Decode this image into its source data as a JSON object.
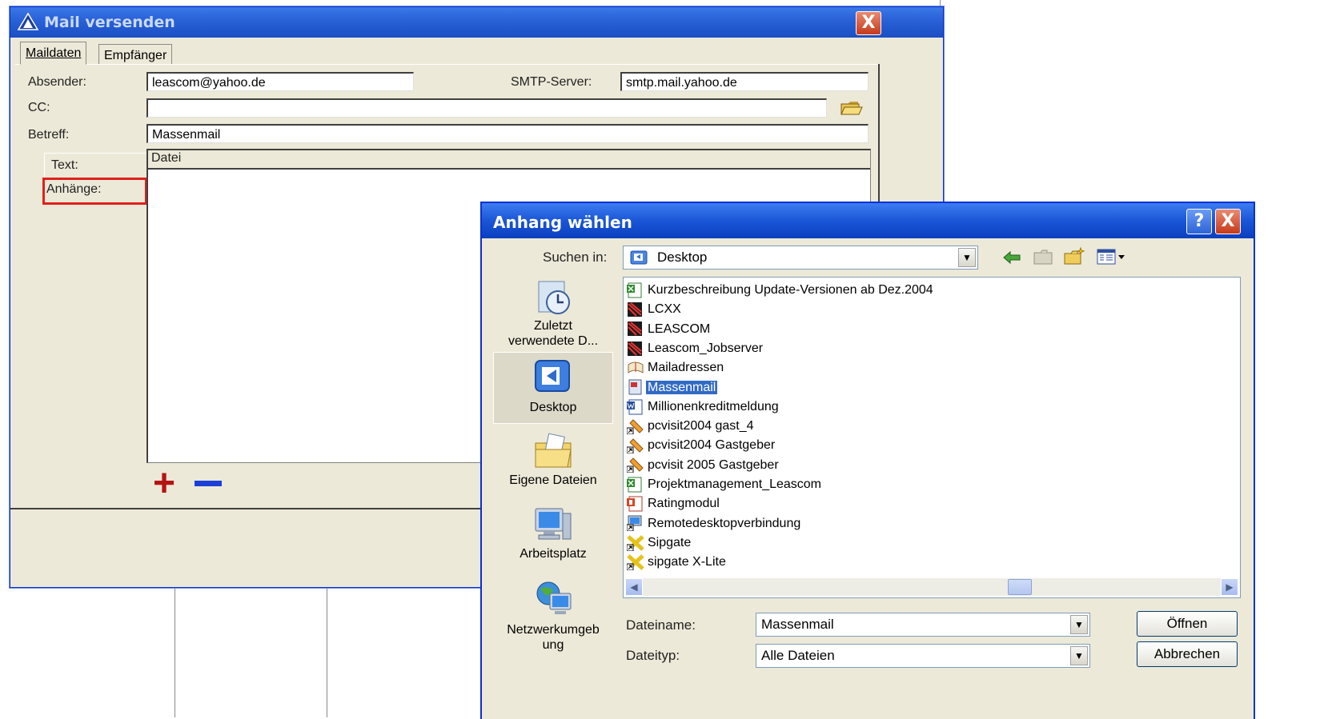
{
  "mail_window": {
    "title": "Mail versenden",
    "close_label": "X",
    "tabs": [
      "Maildaten",
      "Empfänger"
    ],
    "absender_label": "Absender:",
    "absender_value": "leascom@yahoo.de",
    "smtp_label": "SMTP-Server:",
    "smtp_value": "smtp.mail.yahoo.de",
    "cc_label": "CC:",
    "cc_value": "",
    "betreff_label": "Betreff:",
    "betreff_value": "Massenmail",
    "text_label": "Text:",
    "anhaenge_label": "Anhänge:",
    "attachments_column": "Datei",
    "add_label": "+",
    "remove_label": "—",
    "highlight_color": "#e0201c"
  },
  "dialog": {
    "title": "Anhang wählen",
    "help_label": "?",
    "close_label": "X",
    "look_in_label": "Suchen in:",
    "look_in_value": "Desktop",
    "places": [
      {
        "label": "Zuletzt verwendete D...",
        "icon": "recent-documents-icon"
      },
      {
        "label": "Desktop",
        "icon": "desktop-icon"
      },
      {
        "label": "Eigene Dateien",
        "icon": "my-documents-icon"
      },
      {
        "label": "Arbeitsplatz",
        "icon": "my-computer-icon"
      },
      {
        "label": "Netzwerkumgeb ung",
        "icon": "network-icon"
      }
    ],
    "files": [
      {
        "name": "Kurzbeschreibung Update-Versionen ab Dez.2004",
        "icon": "excel-icon"
      },
      {
        "name": "LCXX",
        "icon": "app-shortcut-icon"
      },
      {
        "name": "LEASCOM",
        "icon": "app-shortcut-icon"
      },
      {
        "name": "Leascom_Jobserver",
        "icon": "app-shortcut-icon"
      },
      {
        "name": "Mailadressen",
        "icon": "address-book-icon"
      },
      {
        "name": "Massenmail",
        "icon": "document-icon",
        "selected": true
      },
      {
        "name": "Millionenkreditmeldung",
        "icon": "word-icon"
      },
      {
        "name": "pcvisit2004 gast_4",
        "icon": "shortcut-icon"
      },
      {
        "name": "pcvisit2004 Gastgeber",
        "icon": "shortcut-icon"
      },
      {
        "name": "pcvisit 2005 Gastgeber",
        "icon": "shortcut-icon"
      },
      {
        "name": "Projektmanagement_Leascom",
        "icon": "excel-icon"
      },
      {
        "name": "Ratingmodul",
        "icon": "powerpoint-icon"
      },
      {
        "name": "Remotedesktopverbindung",
        "icon": "remote-desktop-icon"
      },
      {
        "name": "Sipgate",
        "icon": "sipgate-icon"
      },
      {
        "name": "sipgate X-Lite",
        "icon": "sipgate-icon"
      }
    ],
    "filename_label": "Dateiname:",
    "filename_value": "Massenmail",
    "filetype_label": "Dateityp:",
    "filetype_value": "Alle Dateien",
    "open_label": "Öffnen",
    "cancel_label": "Abbrechen"
  }
}
